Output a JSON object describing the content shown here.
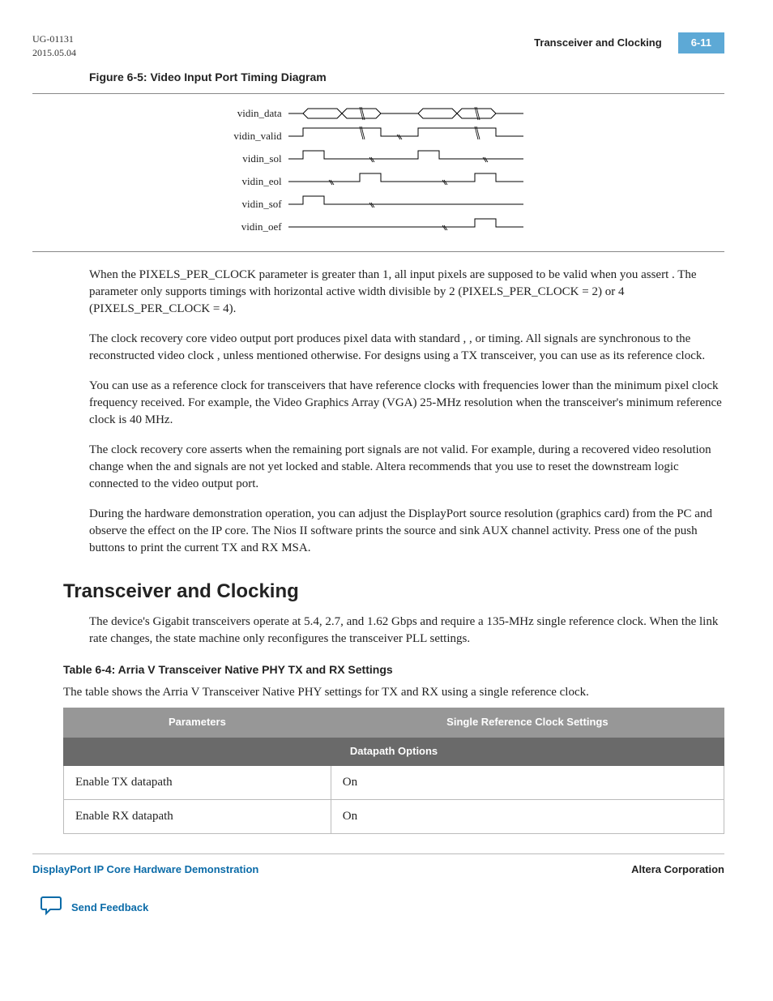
{
  "header": {
    "doc_id": "UG-01131",
    "date": "2015.05.04",
    "title": "Transceiver and Clocking",
    "page": "6-11"
  },
  "figure": {
    "caption": "Figure 6-5: Video Input Port Timing Diagram",
    "signals": [
      "vidin_data",
      "vidin_valid",
      "vidin_sol",
      "vidin_eol",
      "vidin_sof",
      "vidin_oef"
    ]
  },
  "paragraphs": {
    "p1": "When the PIXELS_PER_CLOCK parameter is greater than 1, all input pixels are supposed to be valid when you assert                         . The parameter only supports timings with horizontal active width divisible by 2 (PIXELS_PER_CLOCK = 2) or 4 (PIXELS_PER_CLOCK = 4).",
    "p2": "The clock recovery core video output port produces pixel data with standard             ,            , or           timing. All signals are synchronous to the reconstructed video clock                  , unless mentioned otherwise. For designs using a TX transceiver, you can use                  as its reference clock.",
    "p3": "You can use                        as a reference clock for transceivers that have reference clocks with frequencies lower than the minimum pixel clock frequency received. For example, the Video Graphics Array (VGA) 25-MHz resolution when the transceiver's minimum reference clock is 40 MHz.",
    "p4": "The clock recovery core asserts                        when the remaining port signals are not valid. For example, during a recovered video resolution change when the                  and                    signals are not yet locked and stable. Altera recommends that you use                         to reset the downstream logic connected to the video output port.",
    "p5": "During the hardware demonstration operation, you can adjust the DisplayPort source resolution (graphics card) from the PC and observe the effect on the IP core. The Nios II software prints the source and sink AUX channel activity. Press one of the push buttons to print the current TX and RX MSA."
  },
  "section": {
    "heading": "Transceiver and Clocking",
    "intro": "The device's Gigabit transceivers operate at 5.4, 2.7, and 1.62 Gbps and require a 135-MHz single reference clock. When the link rate changes, the state machine only reconfigures the transceiver PLL settings."
  },
  "table": {
    "caption": "Table 6-4: Arria V Transceiver Native PHY TX and RX Settings",
    "intro": "The table shows the Arria V Transceiver Native PHY settings for TX and RX using a single reference clock.",
    "headers": {
      "col1": "Parameters",
      "col2": "Single Reference Clock Settings"
    },
    "group": "Datapath Options",
    "rows": [
      {
        "param": "Enable TX datapath",
        "value": "On"
      },
      {
        "param": "Enable RX datapath",
        "value": "On"
      }
    ]
  },
  "footer": {
    "left": "DisplayPort IP Core Hardware Demonstration",
    "right": "Altera Corporation",
    "feedback": "Send Feedback"
  }
}
